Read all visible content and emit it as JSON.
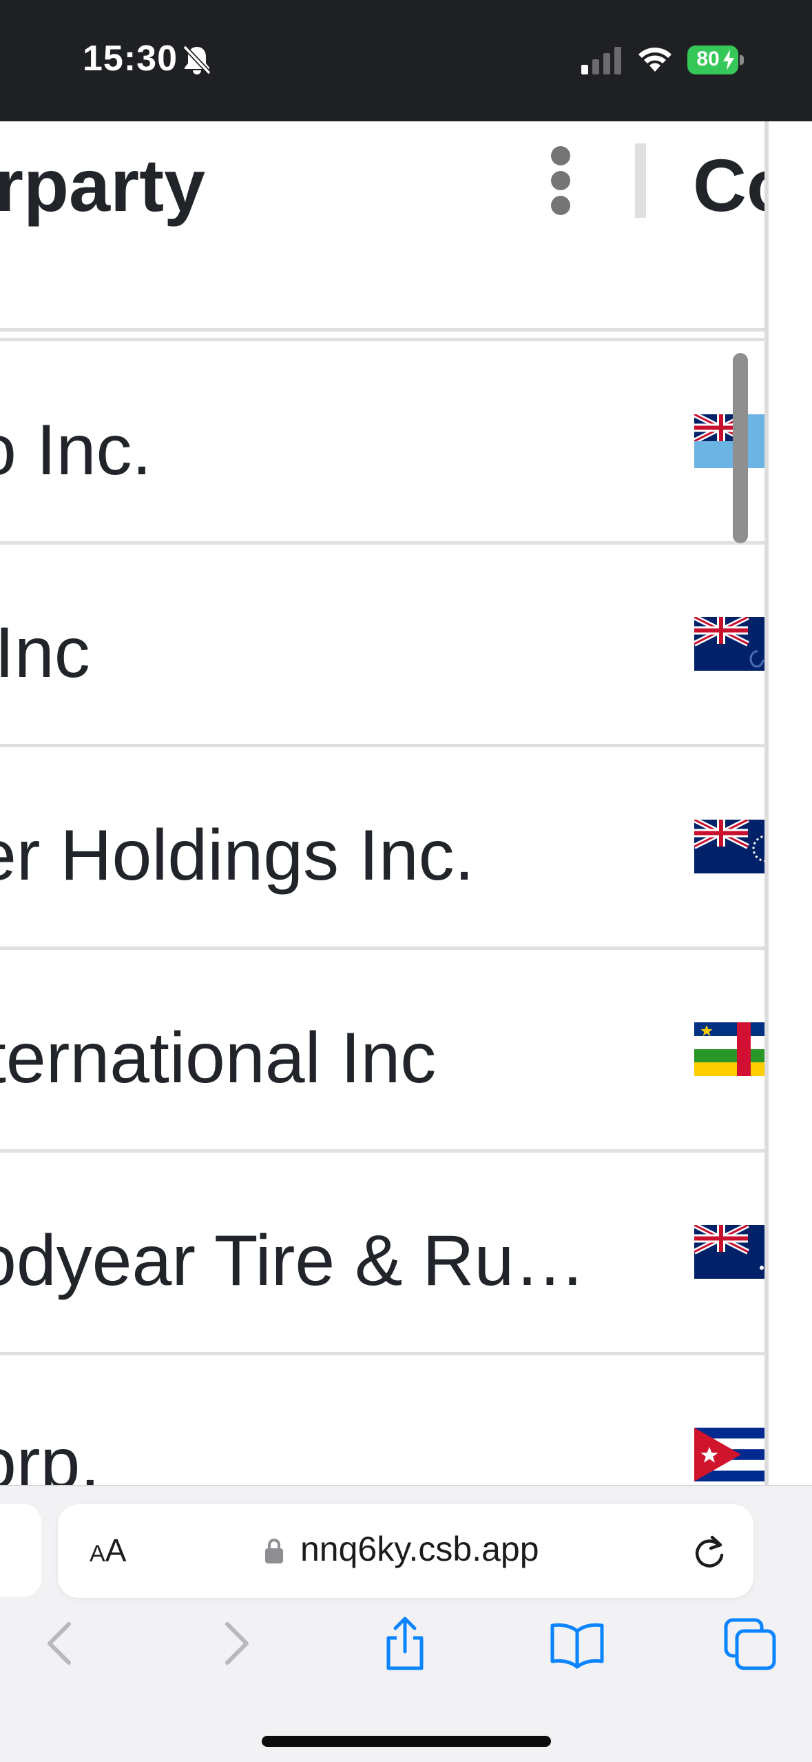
{
  "status_bar": {
    "time": "15:30",
    "battery_percent": "80",
    "icons": [
      "bell-slash-icon",
      "cellular-signal-icon",
      "wifi-icon",
      "battery-charging-icon"
    ]
  },
  "table": {
    "column_header": "rparty",
    "next_column_header": "Co",
    "rows": [
      {
        "name": "o Inc.",
        "flag": "cayman-islands-flag"
      },
      {
        "name": " Inc",
        "flag": "british-ensign-flag"
      },
      {
        "name": "er Holdings Inc.",
        "flag": "cook-islands-flag"
      },
      {
        "name": "ternational Inc",
        "flag": "central-african-republic-flag"
      },
      {
        "name": "odyear Tire & Ru…",
        "flag": "british-ensign-flag"
      },
      {
        "name": "orp.",
        "flag": "cuba-flag"
      }
    ]
  },
  "browser": {
    "text_size_label_small": "A",
    "text_size_label_large": "A",
    "url": "nnq6ky.csb.app",
    "toolbar": [
      "back-icon",
      "forward-icon",
      "share-icon",
      "bookmarks-icon",
      "tabs-icon"
    ]
  },
  "colors": {
    "status_bar_bg": "#1f2023",
    "battery_green": "#36c759",
    "safari_blue": "#0a84ff",
    "divider": "#e0e0e0"
  }
}
